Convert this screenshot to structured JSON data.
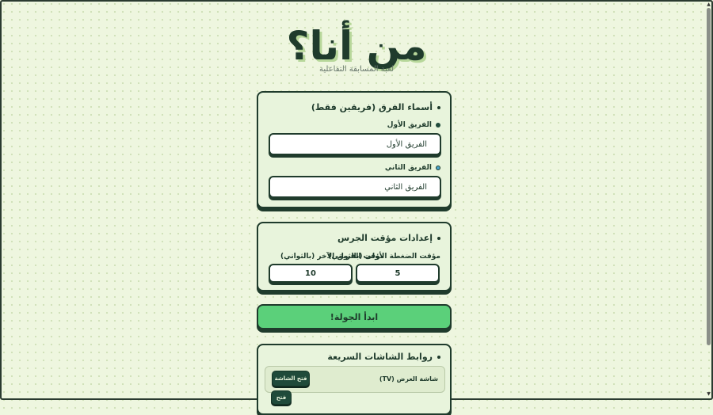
{
  "title": "من أنا؟",
  "subtitle": "لعبة المسابقة التفاعلية",
  "teams": {
    "heading": "أسماء الفرق (فريقين فقط)",
    "team1": {
      "label": "الفريق الأول",
      "value": "الفريق الأول",
      "color": "#1f4a3a"
    },
    "team2": {
      "label": "الفريق الثاني",
      "value": "الفريق الثاني",
      "color": "#4aa3c8"
    }
  },
  "timer": {
    "heading": "إعدادات مؤقت الجرس",
    "first_press_label": "مؤقت الضغطة الأولى (بالثواني)",
    "first_press_value": "5",
    "other_team_label": "مؤقت الفريق الآخر (بالثواني)",
    "other_team_value": "10"
  },
  "start_button": "ابدأ الجولة!",
  "quick_links": {
    "heading": "روابط الشاشات السريعة",
    "items": [
      {
        "label": "شاشة العرض (TV)",
        "button": "فتح الشاشة"
      },
      {
        "label": "",
        "button": "فتح"
      }
    ]
  },
  "colors": {
    "accent": "#5bd07a",
    "dark": "#1f3b2c",
    "card": "#e8f4dc"
  }
}
